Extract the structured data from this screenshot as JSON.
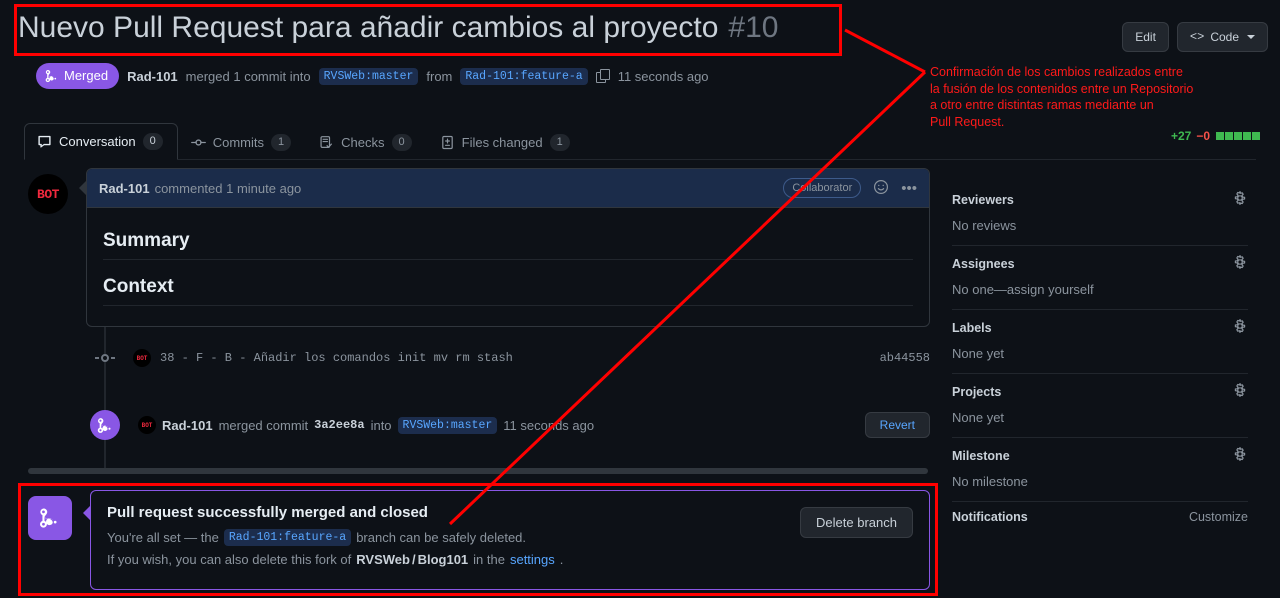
{
  "header": {
    "title": "Nuevo Pull Request para añadir cambios al proyecto",
    "number": "#10",
    "edit_label": "Edit",
    "code_label": "Code",
    "code_glyph": "<>"
  },
  "subhead": {
    "status_badge": "Merged",
    "author": "Rad-101",
    "text_merged": "merged 1 commit into",
    "base_branch": "RVSWeb:master",
    "text_from": "from",
    "head_branch": "Rad-101:feature-a",
    "time": "11 seconds ago"
  },
  "tabs": [
    {
      "label": "Conversation",
      "count": "0",
      "icon": "comment-icon",
      "active": true
    },
    {
      "label": "Commits",
      "count": "1",
      "icon": "commit-icon",
      "active": false
    },
    {
      "label": "Checks",
      "count": "0",
      "icon": "checklist-icon",
      "active": false
    },
    {
      "label": "Files changed",
      "count": "1",
      "icon": "file-diff-icon",
      "active": false
    }
  ],
  "diffstat": {
    "additions": "+27",
    "deletions": "−0",
    "blocks": 5,
    "added_color": "#3fb950",
    "deleted_color": "#f85149"
  },
  "comment": {
    "avatar_text": "BOT",
    "author": "Rad-101",
    "action": "commented 1 minute ago",
    "collaborator_badge": "Collaborator",
    "emoji_icon": "smiley-icon",
    "kebab_icon": "kebab-horizontal-icon",
    "body_headings": [
      "Summary",
      "Context"
    ]
  },
  "commit_row": {
    "avatar_text": "BOT",
    "message": "38 - F - B - Añadir los comandos init mv rm stash",
    "sha": "ab44558"
  },
  "merged_row": {
    "avatar_text": "BOT",
    "author": "Rad-101",
    "action": "merged commit",
    "sha": "3a2ee8a",
    "into": "into",
    "branch": "RVSWeb:master",
    "time": "11 seconds ago",
    "revert_label": "Revert"
  },
  "success": {
    "title": "Pull request successfully merged and closed",
    "line1_pre": "You're all set — the",
    "line1_branch": "Rad-101:feature-a",
    "line1_post": "branch can be safely deleted.",
    "line2_pre": "If you wish, you can also delete this fork of",
    "line2_repo_owner": "RVSWeb",
    "line2_repo_sep": "/",
    "line2_repo_name": "Blog101",
    "line2_mid": "in the",
    "line2_link": "settings",
    "line2_end": ".",
    "delete_button": "Delete branch",
    "accent_color": "#8957e5"
  },
  "sidebar": [
    {
      "title": "Reviewers",
      "value": "No reviews",
      "gear": true
    },
    {
      "title": "Assignees",
      "value": "No one—assign yourself",
      "gear": true
    },
    {
      "title": "Labels",
      "value": "None yet",
      "gear": true
    },
    {
      "title": "Projects",
      "value": "None yet",
      "gear": true
    },
    {
      "title": "Milestone",
      "value": "No milestone",
      "gear": true
    },
    {
      "title": "Notifications",
      "value": "",
      "gear": false,
      "action": "Customize"
    }
  ],
  "annotation": {
    "text": "Confirmación de los cambios realizados entre\nla fusión de los contenidos entre un Repositorio\na otro entre distintas ramas mediante un\nPull Request.",
    "color": "#ff1a1a"
  }
}
